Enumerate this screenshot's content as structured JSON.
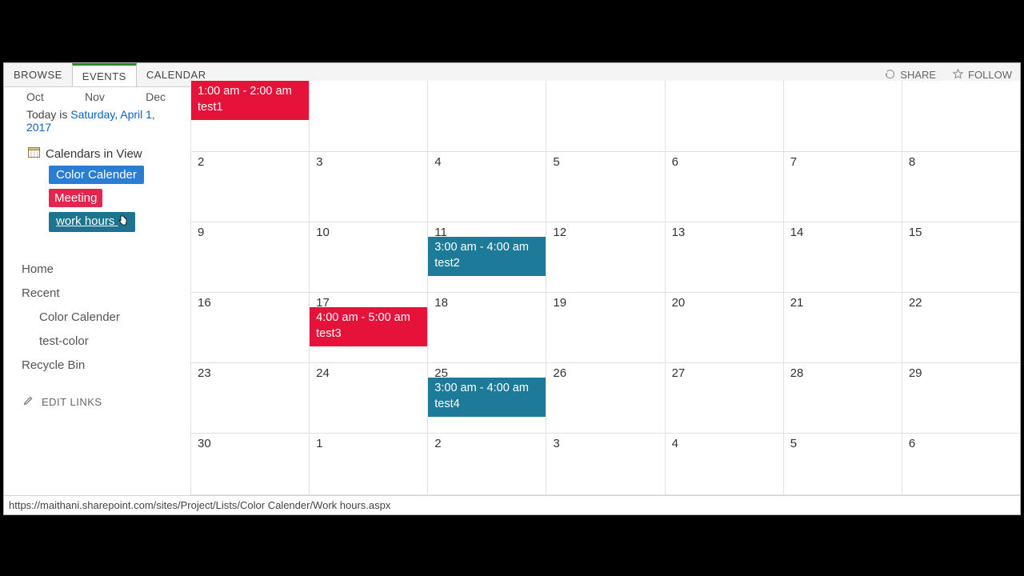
{
  "ribbon": {
    "tabs": [
      "BROWSE",
      "EVENTS",
      "CALENDAR"
    ],
    "active": 1,
    "share": "SHARE",
    "follow": "FOLLOW"
  },
  "sidebar": {
    "months": [
      "Oct",
      "Nov",
      "Dec"
    ],
    "today_prefix": "Today is ",
    "today_date": "Saturday, April 1, 2017",
    "calendars_in_view": "Calendars in View",
    "chips": [
      {
        "label": "Color Calender",
        "color": "blue"
      },
      {
        "label": "Meeting",
        "color": "red"
      },
      {
        "label": "work hours",
        "color": "teal",
        "cursor": true
      }
    ],
    "nav": {
      "home": "Home",
      "recent": "Recent",
      "recent_items": [
        "Color Calender",
        "test-color"
      ],
      "recycle": "Recycle Bin"
    },
    "edit_links": "EDIT LINKS"
  },
  "calendar": {
    "rows": [
      {
        "height": "row-first",
        "days": [
          "",
          "",
          "",
          "",
          "",
          "",
          ""
        ],
        "events": [
          {
            "col": 0,
            "pos": "top0",
            "color": "red",
            "time": "1:00 am - 2:00 am",
            "title": "test1"
          }
        ]
      },
      {
        "days": [
          "2",
          "3",
          "4",
          "5",
          "6",
          "7",
          "8"
        ],
        "events": []
      },
      {
        "days": [
          "9",
          "10",
          "11",
          "12",
          "13",
          "14",
          "15"
        ],
        "events": [
          {
            "col": 2,
            "pos": "mid",
            "color": "teal",
            "time": "3:00 am - 4:00 am",
            "title": "test2"
          }
        ]
      },
      {
        "days": [
          "16",
          "17",
          "18",
          "19",
          "20",
          "21",
          "22"
        ],
        "events": [
          {
            "col": 1,
            "pos": "mid",
            "color": "red",
            "time": "4:00 am - 5:00 am",
            "title": "test3"
          }
        ]
      },
      {
        "days": [
          "23",
          "24",
          "25",
          "26",
          "27",
          "28",
          "29"
        ],
        "events": [
          {
            "col": 2,
            "pos": "mid",
            "color": "teal",
            "time": "3:00 am - 4:00 am",
            "title": "test4"
          }
        ]
      },
      {
        "days": [
          "30",
          "1",
          "2",
          "3",
          "4",
          "5",
          "6"
        ],
        "events": []
      }
    ]
  },
  "status_url": "https://maithani.sharepoint.com/sites/Project/Lists/Color Calender/Work hours.aspx"
}
